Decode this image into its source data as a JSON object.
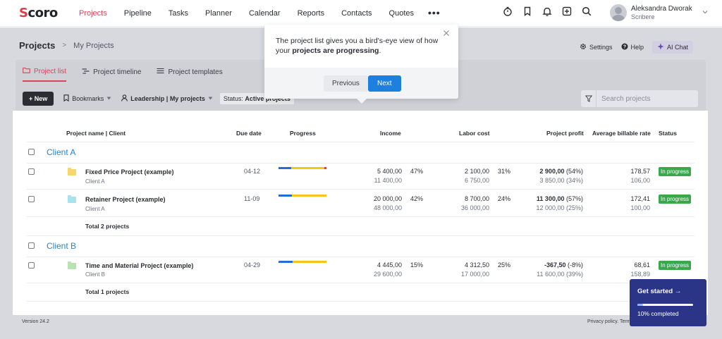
{
  "nav": {
    "logo_s": "S",
    "logo_rest": "coro",
    "items": [
      {
        "label": "Projects"
      },
      {
        "label": "Pipeline"
      },
      {
        "label": "Tasks"
      },
      {
        "label": "Planner"
      },
      {
        "label": "Calendar"
      },
      {
        "label": "Reports"
      },
      {
        "label": "Contacts"
      },
      {
        "label": "Quotes"
      }
    ],
    "more": "•••",
    "user_name": "Aleksandra Dworak",
    "user_role": "Scribere"
  },
  "header": {
    "title": "Projects",
    "separator": ">",
    "subtitle": "My Projects",
    "settings": "Settings",
    "help": "Help",
    "ai_chat": "AI Chat"
  },
  "tabs": [
    {
      "label": "Project list"
    },
    {
      "label": "Project timeline"
    },
    {
      "label": "Project templates"
    }
  ],
  "toolbar": {
    "new": "+ New",
    "bookmarks": "Bookmarks",
    "view": "Leadership | My projects",
    "status_prefix": "Status: ",
    "status_value": "Active projects",
    "search_placeholder": "Search projects"
  },
  "table": {
    "headers": {
      "name": "Project name | Client",
      "due": "Due date",
      "progress": "Progress",
      "income": "Income",
      "labor": "Labor cost",
      "profit": "Project profit",
      "rate": "Average billable rate",
      "status": "Status"
    },
    "groups": [
      {
        "client": "Client A",
        "total": "Total 2 projects",
        "rows": [
          {
            "name": "Fixed Price Project (example)",
            "client": "Client A",
            "due": "04-12",
            "progress_blue": 0.26,
            "progress_yellow": 0.69,
            "progress_red": 0.05,
            "income": "5 400,00",
            "income_sub": "11 400,00",
            "income_pct": "47%",
            "labor": "2 100,00",
            "labor_sub": "6 750,00",
            "labor_pct": "31%",
            "profit": "2 900,00",
            "profit_pct": "(54%)",
            "profit_sub": "3 850,00 (34%)",
            "rate": "178,57",
            "rate_sub": "106,00",
            "status": "In progress",
            "folder_color": "#f6d76b"
          },
          {
            "name": "Retainer Project (example)",
            "client": "Client A",
            "due": "11-09",
            "progress_blue": 0.28,
            "progress_yellow": 0.72,
            "progress_red": 0,
            "income": "20 000,00",
            "income_sub": "48 000,00",
            "income_pct": "42%",
            "labor": "8 700,00",
            "labor_sub": "36 000,00",
            "labor_pct": "24%",
            "profit": "11 300,00",
            "profit_pct": "(57%)",
            "profit_sub": "12 000,00 (25%)",
            "rate": "172,41",
            "rate_sub": "100,00",
            "status": "In progress",
            "folder_color": "#a8e2ec"
          }
        ]
      },
      {
        "client": "Client B",
        "total": "Total 1 projects",
        "rows": [
          {
            "name": "Time and Material Project (example)",
            "client": "Client B",
            "due": "04-29",
            "progress_blue": 0.3,
            "progress_yellow": 0.7,
            "progress_red": 0,
            "income": "4 445,00",
            "income_sub": "29 600,00",
            "income_pct": "15%",
            "labor": "4 312,50",
            "labor_sub": "17 000,00",
            "labor_pct": "25%",
            "profit": "-367,50",
            "profit_pct": "(-8%)",
            "profit_sub": "11 600,00 (39%)",
            "rate": "68,61",
            "rate_sub": "158,89",
            "status": "In progress",
            "folder_color": "#b8e2b0"
          }
        ]
      }
    ]
  },
  "footer": {
    "version": "Version 24.2",
    "policy": "Privacy policy. Term"
  },
  "get_started": {
    "title": "Get started →",
    "progress": 0.1,
    "progress_text": "10% completed"
  },
  "popover": {
    "text_before": "The project list gives you a bird's-eye view of how your ",
    "text_bold": "projects are progressing",
    "text_after": ".",
    "previous": "Previous",
    "next": "Next"
  },
  "colors": {
    "brand": "#e23a4b",
    "active_nav": "#d6455a",
    "link": "#2d83c8",
    "status_green": "#39a84a",
    "primary_button": "#1d7fe0",
    "progress_blue": "#1f6fd6",
    "progress_yellow": "#f5c518",
    "progress_red": "#e23a4b"
  }
}
